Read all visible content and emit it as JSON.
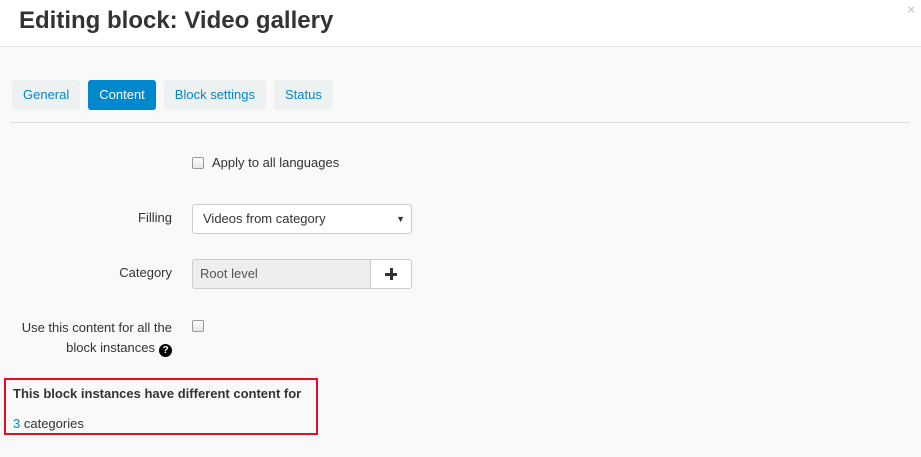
{
  "header": {
    "title": "Editing block: Video gallery",
    "close_glyph": "×"
  },
  "tabs": [
    {
      "label": "General",
      "active": false
    },
    {
      "label": "Content",
      "active": true
    },
    {
      "label": "Block settings",
      "active": false
    },
    {
      "label": "Status",
      "active": false
    }
  ],
  "form": {
    "apply_all_languages": {
      "label": "Apply to all languages",
      "checked": false
    },
    "filling": {
      "label": "Filling",
      "value": "Videos from category",
      "caret": "▼"
    },
    "category": {
      "label": "Category",
      "value": "Root level",
      "button_icon": "plus-icon"
    },
    "use_for_all_instances": {
      "label_line1": "Use this content for all the",
      "label_line2": "block instances",
      "help_icon": "question-circle-icon",
      "checked": false
    }
  },
  "notice": {
    "title": "This block instances have different content for",
    "count": "3",
    "suffix": " categories",
    "border_color": "#e01020"
  },
  "colors": {
    "accent": "#0088cc",
    "tab_bg": "#edf1f2",
    "body_bg": "#f9f9f9"
  }
}
